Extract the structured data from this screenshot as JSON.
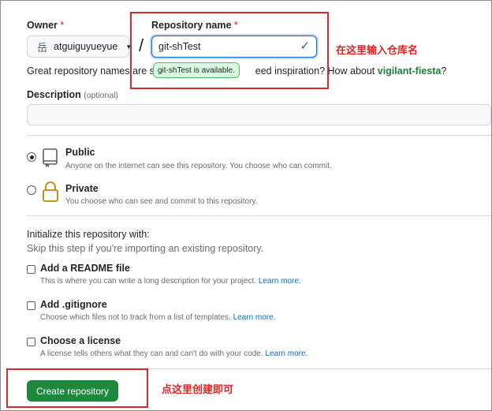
{
  "owner": {
    "label": "Owner",
    "required_mark": "*",
    "avatar_glyph": "岳",
    "value": "atguiguyueyue"
  },
  "repository": {
    "label": "Repository name",
    "required_mark": "*",
    "separator": "/",
    "value": "git-shTest",
    "availability_tooltip": "git-shTest is available."
  },
  "suggestion": {
    "text_before": "Great repository names are sho",
    "text_after": "eed inspiration? How about ",
    "name": "vigilant-fiesta",
    "end": "?"
  },
  "description": {
    "label": "Description",
    "optional": "(optional)",
    "value": ""
  },
  "visibility": {
    "options": [
      {
        "title": "Public",
        "desc": "Anyone on the internet can see this repository. You choose who can commit.",
        "selected": true,
        "icon": "repo-icon"
      },
      {
        "title": "Private",
        "desc": "You choose who can see and commit to this repository.",
        "selected": false,
        "icon": "lock-icon"
      }
    ]
  },
  "init": {
    "heading": "Initialize this repository with:",
    "subheading": "Skip this step if you're importing an existing repository.",
    "learn_more": "Learn more.",
    "options": [
      {
        "title": "Add a README file",
        "desc": "This is where you can write a long description for your project.",
        "checked": false
      },
      {
        "title": "Add .gitignore",
        "desc": "Choose which files not to track from a list of templates.",
        "checked": false
      },
      {
        "title": "Choose a license",
        "desc": "A license tells others what they can and can't do with your code.",
        "checked": false
      }
    ]
  },
  "create_button": "Create repository",
  "annotations": {
    "repo_name_hint": "在这里输入仓库名",
    "create_hint": "点这里创建即可",
    "color": "#e02424"
  },
  "colors": {
    "accent_blue": "#0969da",
    "button_green": "#1f883d",
    "success_green": "#1a7f37"
  }
}
